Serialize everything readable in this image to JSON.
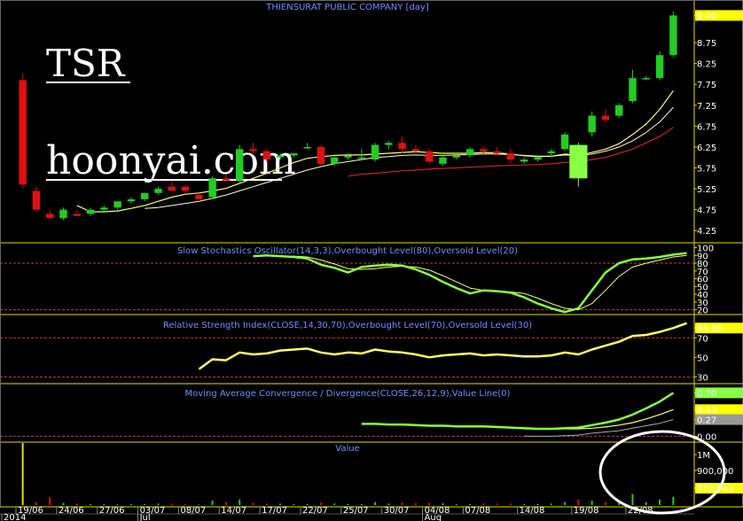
{
  "title": "THIENSURAT PUBLIC COMPANY [day]",
  "watermark": {
    "ticker": "TSR",
    "site": "hoonyai.com"
  },
  "colors": {
    "up": "#22cc22",
    "down": "#dd1111",
    "highlight": "#88ff44",
    "frame": "#e0e000",
    "sma_fast": "#ffff66",
    "sma_mid": "#ffffcc",
    "sma_slow": "#cc2222",
    "guide": "#c04040",
    "axis_label_bg": "#ffff00"
  },
  "chart_data": [
    {
      "type": "candlestick",
      "name": "price",
      "yticks": [
        4.25,
        4.75,
        5.25,
        5.75,
        6.25,
        6.75,
        7.25,
        7.75,
        8.25,
        8.75,
        9.4
      ],
      "last_label": "9.40",
      "ylim": [
        4.0,
        9.6
      ],
      "x_labels": [
        "19/06",
        "24/06",
        "27/06",
        "03/07",
        "08/07",
        "14/07",
        "17/07",
        "22/07",
        "25/07",
        "30/07",
        "04/08",
        "07/08",
        "14/08",
        "19/08",
        "22/08"
      ],
      "month_labels": [
        "2014",
        "Jul",
        "Aug"
      ],
      "candles": [
        {
          "o": 7.85,
          "h": 8.0,
          "l": 5.25,
          "c": 5.35
        },
        {
          "o": 5.2,
          "h": 5.3,
          "l": 4.7,
          "c": 4.75
        },
        {
          "o": 4.65,
          "h": 4.75,
          "l": 4.5,
          "c": 4.55
        },
        {
          "o": 4.55,
          "h": 4.8,
          "l": 4.5,
          "c": 4.75
        },
        {
          "o": 4.65,
          "h": 4.75,
          "l": 4.6,
          "c": 4.6
        },
        {
          "o": 4.65,
          "h": 4.8,
          "l": 4.6,
          "c": 4.75
        },
        {
          "o": 4.75,
          "h": 4.85,
          "l": 4.7,
          "c": 4.8
        },
        {
          "o": 4.8,
          "h": 4.95,
          "l": 4.75,
          "c": 4.95
        },
        {
          "o": 4.95,
          "h": 5.05,
          "l": 4.9,
          "c": 5.0
        },
        {
          "o": 5.0,
          "h": 5.15,
          "l": 4.95,
          "c": 5.15
        },
        {
          "o": 5.15,
          "h": 5.3,
          "l": 5.1,
          "c": 5.25
        },
        {
          "o": 5.3,
          "h": 5.4,
          "l": 5.2,
          "c": 5.2
        },
        {
          "o": 5.3,
          "h": 5.35,
          "l": 5.15,
          "c": 5.2
        },
        {
          "o": 5.1,
          "h": 5.15,
          "l": 5.0,
          "c": 5.0
        },
        {
          "o": 5.05,
          "h": 5.55,
          "l": 5.0,
          "c": 5.5
        },
        {
          "o": 5.5,
          "h": 5.6,
          "l": 5.4,
          "c": 5.45
        },
        {
          "o": 5.45,
          "h": 6.3,
          "l": 5.4,
          "c": 6.2
        },
        {
          "o": 6.2,
          "h": 6.35,
          "l": 6.1,
          "c": 6.15
        },
        {
          "o": 6.15,
          "h": 6.2,
          "l": 5.9,
          "c": 5.95
        },
        {
          "o": 6.0,
          "h": 6.1,
          "l": 5.95,
          "c": 6.05
        },
        {
          "o": 6.05,
          "h": 6.1,
          "l": 6.0,
          "c": 6.1
        },
        {
          "o": 6.25,
          "h": 6.35,
          "l": 6.2,
          "c": 6.25
        },
        {
          "o": 6.25,
          "h": 6.3,
          "l": 5.8,
          "c": 5.85
        },
        {
          "o": 5.85,
          "h": 6.05,
          "l": 5.8,
          "c": 6.0
        },
        {
          "o": 6.0,
          "h": 6.1,
          "l": 5.95,
          "c": 6.05
        },
        {
          "o": 6.0,
          "h": 6.2,
          "l": 5.95,
          "c": 6.0
        },
        {
          "o": 5.95,
          "h": 6.35,
          "l": 5.9,
          "c": 6.3
        },
        {
          "o": 6.3,
          "h": 6.4,
          "l": 6.2,
          "c": 6.35
        },
        {
          "o": 6.35,
          "h": 6.5,
          "l": 6.1,
          "c": 6.2
        },
        {
          "o": 6.2,
          "h": 6.3,
          "l": 6.1,
          "c": 6.15
        },
        {
          "o": 6.15,
          "h": 6.2,
          "l": 5.85,
          "c": 5.9
        },
        {
          "o": 5.85,
          "h": 6.05,
          "l": 5.8,
          "c": 6.0
        },
        {
          "o": 6.0,
          "h": 6.1,
          "l": 5.95,
          "c": 6.05
        },
        {
          "o": 6.05,
          "h": 6.25,
          "l": 6.0,
          "c": 6.2
        },
        {
          "o": 6.2,
          "h": 6.25,
          "l": 6.1,
          "c": 6.15
        },
        {
          "o": 6.15,
          "h": 6.25,
          "l": 6.05,
          "c": 6.1
        },
        {
          "o": 6.1,
          "h": 6.2,
          "l": 5.85,
          "c": 5.95
        },
        {
          "o": 5.9,
          "h": 6.0,
          "l": 5.85,
          "c": 5.95
        },
        {
          "o": 5.95,
          "h": 6.05,
          "l": 5.9,
          "c": 6.0
        },
        {
          "o": 6.1,
          "h": 6.2,
          "l": 6.0,
          "c": 6.15
        },
        {
          "o": 6.2,
          "h": 6.6,
          "l": 6.15,
          "c": 6.55
        },
        {
          "o": 6.3,
          "h": 6.35,
          "l": 5.3,
          "c": 5.5
        },
        {
          "o": 6.6,
          "h": 7.1,
          "l": 6.5,
          "c": 7.0
        },
        {
          "o": 7.0,
          "h": 7.15,
          "l": 6.85,
          "c": 6.9
        },
        {
          "o": 7.0,
          "h": 7.3,
          "l": 6.95,
          "c": 7.25
        },
        {
          "o": 7.35,
          "h": 8.1,
          "l": 7.3,
          "c": 7.9
        },
        {
          "o": 7.9,
          "h": 7.95,
          "l": 7.85,
          "c": 7.9
        },
        {
          "o": 7.9,
          "h": 8.55,
          "l": 7.85,
          "c": 8.45
        },
        {
          "o": 8.45,
          "h": 9.5,
          "l": 8.4,
          "c": 9.4
        }
      ],
      "highlight_index": 41,
      "sma_fast": [
        null,
        null,
        null,
        null,
        4.85,
        4.7,
        4.7,
        4.72,
        4.78,
        4.85,
        4.95,
        5.05,
        5.12,
        5.15,
        5.2,
        5.26,
        5.38,
        5.5,
        5.62,
        5.75,
        5.88,
        5.98,
        6.02,
        6.05,
        6.06,
        6.06,
        6.08,
        6.1,
        6.12,
        6.14,
        6.12,
        6.1,
        6.1,
        6.1,
        6.12,
        6.11,
        6.08,
        6.04,
        6.02,
        6.03,
        6.08,
        6.05,
        6.12,
        6.2,
        6.33,
        6.55,
        6.8,
        7.15,
        7.6
      ],
      "sma_mid": [
        null,
        null,
        null,
        null,
        null,
        null,
        null,
        null,
        null,
        4.78,
        4.8,
        4.85,
        4.9,
        4.95,
        5.02,
        5.1,
        5.2,
        5.3,
        5.4,
        5.5,
        5.6,
        5.7,
        5.78,
        5.85,
        5.9,
        5.95,
        6.0,
        6.02,
        6.05,
        6.06,
        6.05,
        6.05,
        6.06,
        6.07,
        6.08,
        6.08,
        6.07,
        6.05,
        6.03,
        6.03,
        6.06,
        6.04,
        6.08,
        6.15,
        6.25,
        6.4,
        6.6,
        6.85,
        7.2
      ],
      "sma_slow": [
        null,
        null,
        null,
        null,
        null,
        null,
        null,
        null,
        null,
        null,
        null,
        null,
        null,
        null,
        null,
        null,
        null,
        null,
        null,
        null,
        null,
        null,
        null,
        null,
        5.55,
        5.6,
        5.62,
        5.65,
        5.68,
        5.7,
        5.72,
        5.74,
        5.75,
        5.77,
        5.78,
        5.8,
        5.81,
        5.82,
        5.83,
        5.85,
        5.88,
        5.9,
        5.95,
        6.0,
        6.1,
        6.2,
        6.35,
        6.5,
        6.72
      ]
    },
    {
      "type": "line",
      "name": "stochastic",
      "title": "Slow Stochastics Oscillator(14,3,3),Overbought Level(80),Oversold Level(20)",
      "yticks": [
        100,
        90,
        80,
        70,
        60,
        50,
        40,
        30,
        20
      ],
      "levels": [
        80,
        20
      ],
      "ylim": [
        15,
        104
      ],
      "k": [
        null,
        null,
        null,
        null,
        null,
        null,
        null,
        null,
        null,
        null,
        null,
        null,
        null,
        null,
        null,
        null,
        null,
        89,
        90,
        89,
        88,
        86,
        78,
        74,
        68,
        75,
        77,
        78,
        77,
        72,
        65,
        56,
        48,
        41,
        45,
        44,
        42,
        36,
        28,
        22,
        17,
        22,
        45,
        68,
        80,
        85,
        86,
        88,
        91,
        93
      ],
      "d": [
        null,
        null,
        null,
        null,
        null,
        null,
        null,
        null,
        null,
        null,
        null,
        null,
        null,
        null,
        null,
        null,
        null,
        null,
        null,
        89,
        89,
        88,
        84,
        79,
        73,
        72,
        73,
        75,
        76,
        75,
        71,
        64,
        56,
        48,
        45,
        43,
        43,
        41,
        35,
        28,
        22,
        20,
        28,
        45,
        63,
        75,
        80,
        84,
        88,
        90
      ]
    },
    {
      "type": "line",
      "name": "rsi",
      "title": "Relative Strength Index(CLOSE,14,30,70),Overbought Level(70),Oversold Level(30)",
      "yticks": [
        70,
        50,
        30
      ],
      "levels": [
        70,
        30
      ],
      "last_label": "84.96",
      "ylim": [
        24,
        92
      ],
      "values": [
        null,
        null,
        null,
        null,
        null,
        null,
        null,
        null,
        null,
        null,
        null,
        null,
        null,
        38,
        48,
        47,
        55,
        53,
        54,
        57,
        58,
        59,
        55,
        53,
        55,
        54,
        58,
        56,
        55,
        53,
        50,
        52,
        53,
        54,
        52,
        53,
        52,
        51,
        51,
        52,
        55,
        53,
        58,
        62,
        66,
        72,
        73,
        76,
        80,
        85
      ]
    },
    {
      "type": "line",
      "name": "macd",
      "title": "Moving Average Convergence / Divergence(CLOSE,26,12,9),Value Line(0)",
      "yticks": [
        0.0
      ],
      "value_labels": [
        "0.70",
        "0.43",
        "0.27"
      ],
      "ylim": [
        -0.08,
        0.82
      ],
      "macd": [
        null,
        null,
        null,
        null,
        null,
        null,
        null,
        null,
        null,
        null,
        null,
        null,
        null,
        null,
        null,
        null,
        null,
        null,
        null,
        null,
        null,
        null,
        null,
        null,
        null,
        0.2,
        0.2,
        0.19,
        0.19,
        0.18,
        0.17,
        0.17,
        0.16,
        0.16,
        0.16,
        0.15,
        0.14,
        0.13,
        0.12,
        0.12,
        0.13,
        0.14,
        0.18,
        0.22,
        0.27,
        0.35,
        0.45,
        0.56,
        0.7
      ],
      "signal": [
        null,
        null,
        null,
        null,
        null,
        null,
        null,
        null,
        null,
        null,
        null,
        null,
        null,
        null,
        null,
        null,
        null,
        null,
        null,
        null,
        null,
        null,
        null,
        null,
        null,
        null,
        null,
        null,
        null,
        null,
        null,
        null,
        null,
        null,
        null,
        null,
        null,
        0.12,
        0.12,
        0.12,
        0.12,
        0.12,
        0.13,
        0.15,
        0.18,
        0.22,
        0.28,
        0.35,
        0.43
      ],
      "hist": [
        null,
        null,
        null,
        null,
        null,
        null,
        null,
        null,
        null,
        null,
        null,
        null,
        null,
        null,
        null,
        null,
        null,
        null,
        null,
        null,
        null,
        null,
        null,
        null,
        null,
        null,
        null,
        null,
        null,
        null,
        null,
        null,
        null,
        null,
        null,
        null,
        null,
        0.0,
        0.0,
        0.0,
        0.01,
        0.02,
        0.05,
        0.07,
        0.09,
        0.13,
        0.17,
        0.21,
        0.27
      ]
    },
    {
      "type": "bar",
      "name": "value",
      "title": "Value",
      "yticks": [
        "1M",
        "900,000"
      ],
      "last_label": "222,743",
      "ylim": [
        0,
        1400000
      ],
      "values": [
        2600000,
        80000,
        210000,
        60000,
        40000,
        30000,
        30000,
        20000,
        30000,
        30000,
        40000,
        40000,
        30000,
        30000,
        120000,
        80000,
        150000,
        60000,
        40000,
        40000,
        30000,
        30000,
        60000,
        40000,
        30000,
        30000,
        80000,
        40000,
        60000,
        50000,
        60000,
        50000,
        30000,
        30000,
        50000,
        40000,
        40000,
        30000,
        30000,
        40000,
        80000,
        150000,
        120000,
        80000,
        80000,
        300000,
        80000,
        150000,
        222743
      ]
    }
  ]
}
